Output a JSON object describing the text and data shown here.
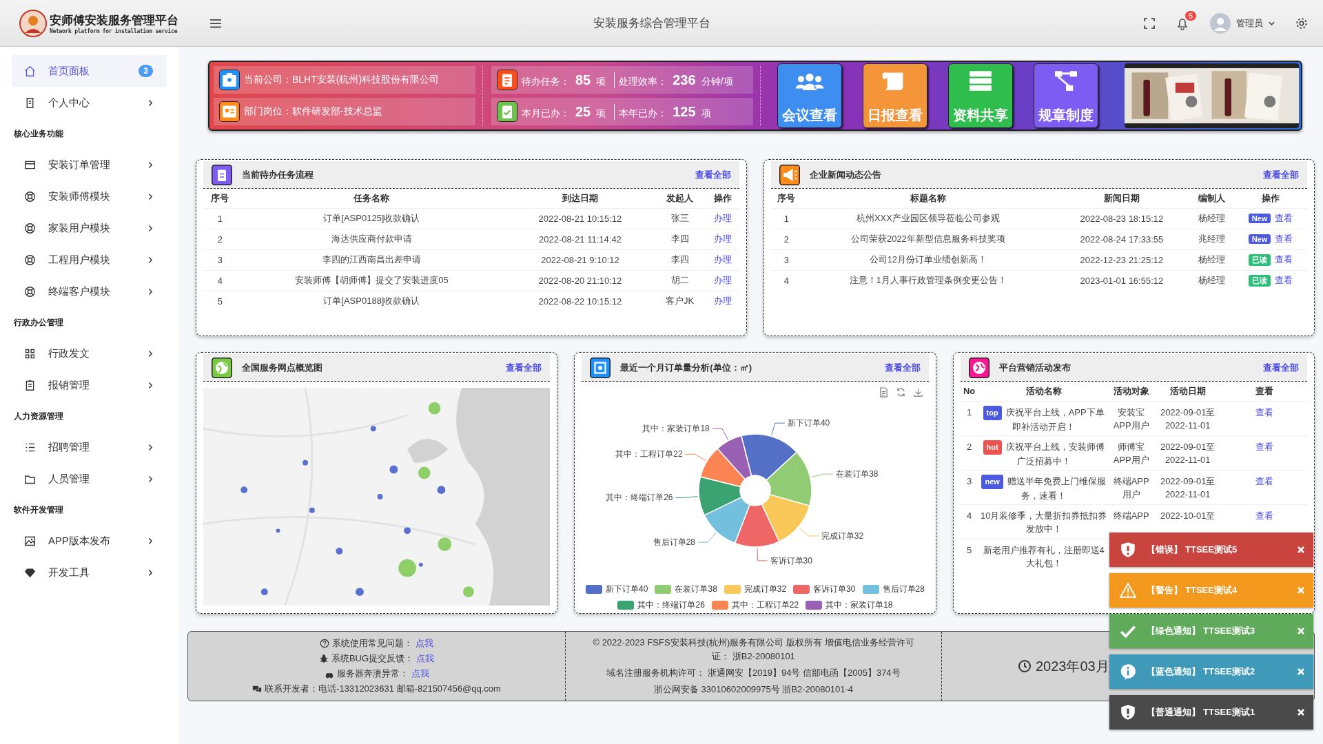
{
  "header": {
    "logo_title": "安师傅安装服务管理平台",
    "logo_subtitle": "Network platform for installation service",
    "title": "安装服务综合管理平台",
    "notification_count": "5",
    "user": "管理员"
  },
  "sidebar": {
    "items": [
      {
        "kind": "item",
        "label": "首页面板",
        "badge": "3",
        "selected": true
      },
      {
        "kind": "item",
        "label": "个人中心",
        "selected": false
      },
      {
        "kind": "section",
        "label": "核心业务功能"
      },
      {
        "kind": "item",
        "label": "安装订单管理",
        "selected": false
      },
      {
        "kind": "item",
        "label": "安装师傅模块",
        "selected": false
      },
      {
        "kind": "item",
        "label": "家装用户模块",
        "selected": false
      },
      {
        "kind": "item",
        "label": "工程用户模块",
        "selected": false
      },
      {
        "kind": "item",
        "label": "终端客户模块",
        "selected": false
      },
      {
        "kind": "section",
        "label": "行政办公管理"
      },
      {
        "kind": "item",
        "label": "行政发文",
        "selected": false
      },
      {
        "kind": "item",
        "label": "报销管理",
        "selected": false
      },
      {
        "kind": "section",
        "label": "人力资源管理"
      },
      {
        "kind": "item",
        "label": "招聘管理",
        "selected": false
      },
      {
        "kind": "item",
        "label": "人员管理",
        "selected": false
      },
      {
        "kind": "section",
        "label": "软件开发管理"
      },
      {
        "kind": "item",
        "label": "APP版本发布",
        "selected": false
      },
      {
        "kind": "item",
        "label": "开发工具",
        "selected": false
      }
    ]
  },
  "banner": {
    "info": [
      "当前公司：BLHT安装(杭州)科技股份有限公司",
      "部门岗位：软件研发部-技术总监"
    ],
    "stats": [
      [
        {
          "label": "待办任务：",
          "value": "85",
          "unit": "项"
        },
        {
          "label": "处理效率：",
          "value": "236",
          "unit": "分钟/项"
        }
      ],
      [
        {
          "label": "本月已办：",
          "value": "25",
          "unit": "项"
        },
        {
          "label": "本年已办：",
          "value": "125",
          "unit": "项"
        }
      ]
    ],
    "tiles": [
      "会议查看",
      "日报查看",
      "资料共享",
      "规章制度"
    ],
    "image": {
      "kind": "picture"
    }
  },
  "tasks": {
    "title": "当前待办任务流程",
    "link": "查看全部",
    "columns": [
      "序号",
      "任务名称",
      "到达日期",
      "发起人",
      "操作"
    ],
    "rows": [
      {
        "cells": [
          "1",
          "订单[ASP0125]收款确认",
          "2022-08-21 10:15:12",
          "张三"
        ],
        "action": "办理"
      },
      {
        "cells": [
          "2",
          "海达供应商付款申请",
          "2022-08-21 11:14:42",
          "李四"
        ],
        "action": "办理"
      },
      {
        "cells": [
          "3",
          "李四的江西南昌出差申请",
          "2022-08-21 9:10:12",
          "李四"
        ],
        "action": "办理"
      },
      {
        "cells": [
          "4",
          "安装师傅【胡师傅】提交了安装进度05",
          "2022-08-20 21:10:12",
          "胡二"
        ],
        "action": "办理"
      },
      {
        "cells": [
          "5",
          "订单[ASP0188]收款确认",
          "2022-08-22 10:15:12",
          "客户JK"
        ],
        "action": "办理"
      }
    ]
  },
  "news": {
    "title": "企业新闻动态公告",
    "link": "查看全部",
    "columns": [
      "序号",
      "标题名称",
      "新闻日期",
      "编制人",
      "操作"
    ],
    "rows": [
      {
        "cells": [
          "1",
          "杭州XXX产业园区领导莅临公司参观",
          "2022-08-23 18:15:12",
          "杨经理"
        ],
        "tag": {
          "kind": "new",
          "text": "New"
        },
        "action": "查看"
      },
      {
        "cells": [
          "2",
          "公司荣获2022年新型信息服务科技奖项",
          "2022-08-24 17:33:55",
          "兆经理"
        ],
        "tag": {
          "kind": "new",
          "text": "New"
        },
        "action": "查看"
      },
      {
        "cells": [
          "3",
          "公司12月份订单业绩创新高！",
          "2022-12-23 21:25:12",
          "杨经理"
        ],
        "tag": {
          "kind": "read",
          "text": "已读"
        },
        "action": "查看"
      },
      {
        "cells": [
          "4",
          "注意！1月人事行政管理条例变更公告！",
          "2023-01-01 16:55:12",
          "杨经理"
        ],
        "tag": {
          "kind": "read",
          "text": "已读"
        },
        "action": "查看"
      }
    ]
  },
  "map": {
    "title": "全国服务网点概览图",
    "link": "查看全部",
    "image": {
      "kind": "picture"
    }
  },
  "orders": {
    "title": "最近一个月订单量分析(单位：㎡)",
    "link": "查看全部",
    "chart_data": {
      "type": "donut",
      "categories": [
        "新下订单",
        "在装订单",
        "完成订单",
        "客诉订单",
        "售后订单",
        "其中：终端订单",
        "其中：工程订单",
        "其中：家装订单"
      ],
      "values": [
        40,
        38,
        32,
        30,
        28,
        26,
        22,
        18
      ],
      "data_labels": true
    },
    "legend_items": [
      "新下订单40",
      "在装订单38",
      "完成订单32",
      "客诉订单30",
      "售后订单28",
      "其中：终端订单26",
      "其中：工程订单22",
      "其中：家装订单18"
    ]
  },
  "marketing": {
    "title": "平台营销活动发布",
    "link": "查看全部",
    "columns": [
      "No",
      "活动名称",
      "活动对象",
      "活动日期",
      "查看"
    ],
    "rows": [
      {
        "no": "1",
        "tag": {
          "kind": "top",
          "text": "top"
        },
        "name": "庆祝平台上线，APP下单即补活动开启！",
        "target": "安装宝APP用户",
        "date": "2022-09-01至2022-11-01",
        "action": "查看"
      },
      {
        "no": "2",
        "tag": {
          "kind": "hot",
          "text": "hot"
        },
        "name": "庆祝平台上线，安装师傅广泛招募中！",
        "target": "师傅宝APP用户",
        "date": "2022-09-01至2022-11-01",
        "action": "查看"
      },
      {
        "no": "3",
        "tag": {
          "kind": "new",
          "text": "new"
        },
        "name": "赠送半年免费上门维保服务，速看！",
        "target": "终端APP用户",
        "date": "2022-09-01至2022-11-01",
        "action": "查看"
      },
      {
        "no": "4",
        "name": "10月装修季，大量折扣券抵扣券发放中！",
        "target": "终端APP",
        "date": "2022-10-01至",
        "action": "查看"
      },
      {
        "no": "5",
        "name": "新老用户推荐有礼，注册即送4 大礼包！"
      }
    ]
  },
  "footer": {
    "help": [
      {
        "label": "系统使用常见问题：",
        "link": "点我"
      },
      {
        "label": "系统BUG提交反馈：",
        "link": "点我"
      },
      {
        "label": "服务器奔溃异常：",
        "link": "点我"
      },
      {
        "label": "联系开发者：电话-13312023631 邮箱-821507456@qq.com"
      }
    ],
    "legal": [
      "© 2022-2023 FSFS安装科技(杭州)服务有限公司 版权所有 增值电信业务经营许可证： 浙B2-20080101",
      "域名注册服务机构许可： 浙通网安【2019】94号 信部电函【2005】374号",
      "浙公网安备 33010602009975号 浙B2-20080101-4"
    ],
    "clock": "2023年03月"
  },
  "toasts": [
    {
      "kind": "error",
      "title": "【错误】",
      "text": "TTSEE测试5"
    },
    {
      "kind": "warning",
      "title": "【警告】",
      "text": "TTSEE测试4"
    },
    {
      "kind": "success",
      "title": "【绿色通知】",
      "text": "TTSEE测试3"
    },
    {
      "kind": "info",
      "title": "【蓝色通知】",
      "text": "TTSEE测试2"
    },
    {
      "kind": "normal",
      "title": "【普通通知】",
      "text": "TTSEE测试1"
    }
  ]
}
